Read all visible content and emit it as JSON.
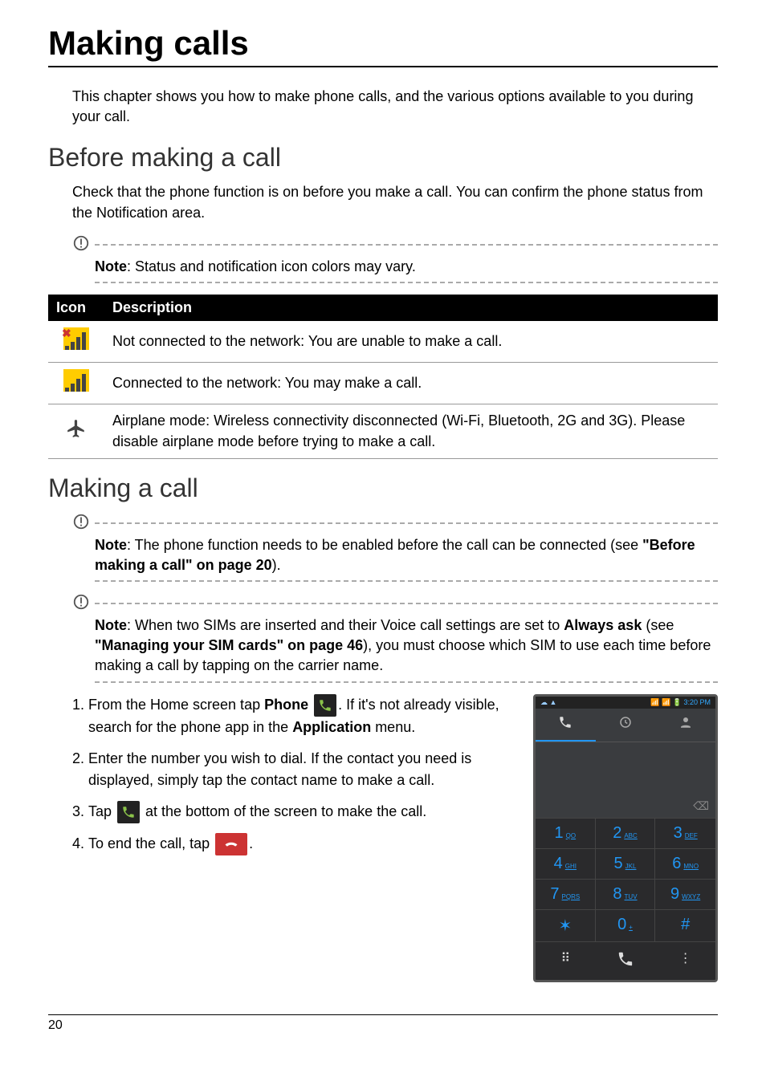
{
  "page_title": "Making calls",
  "intro": "This chapter shows you how to make phone calls, and the various options available to you during your call.",
  "section1": {
    "heading": "Before making a call",
    "text": "Check that the phone function is on before you make a call. You can confirm the phone status from the Notification area."
  },
  "note1": {
    "label": "Note",
    "text": ": Status and notification icon colors may vary."
  },
  "table": {
    "col_icon": "Icon",
    "col_desc": "Description",
    "rows": [
      {
        "desc": "Not connected to the network: You are unable to make a call."
      },
      {
        "desc": "Connected to the network: You may make a call."
      },
      {
        "desc": "Airplane mode: Wireless connectivity disconnected (Wi-Fi, Bluetooth, 2G and 3G). Please disable airplane mode before trying to make a call."
      }
    ]
  },
  "section2": {
    "heading": "Making a call"
  },
  "note2": {
    "label": "Note",
    "text1": ": The phone function needs to be enabled before the call can be connected (see ",
    "bold": "\"Before making a call\" on page 20",
    "text2": ")."
  },
  "note3": {
    "label": "Note",
    "t1": ": When two SIMs are inserted and their Voice call settings are set to ",
    "b1": "Always ask",
    "t2": " (see ",
    "b2": "\"Managing your SIM cards\" on page 46",
    "t3": "), you must choose which SIM to use each time before making a call by tapping on the carrier name."
  },
  "steps": {
    "s1a": "From the Home screen tap ",
    "s1b": "Phone",
    "s1c": ". If it's not already visible, search for the phone app in the ",
    "s1d": "Application",
    "s1e": " menu.",
    "s2": "Enter the number you wish to dial. If the contact you need is displayed, simply tap the contact name to make a call.",
    "s3a": "Tap ",
    "s3b": " at the bottom of the screen to make the call.",
    "s4a": "To end the call, tap ",
    "s4b": "."
  },
  "phone": {
    "status_left": "☁ ▲",
    "status_right": "📶 📶 🔋 3:20 PM",
    "backspace": "⌫",
    "keys": [
      {
        "n": "1",
        "l": "QO"
      },
      {
        "n": "2",
        "l": "ABC"
      },
      {
        "n": "3",
        "l": "DEF"
      },
      {
        "n": "4",
        "l": "GHI"
      },
      {
        "n": "5",
        "l": "JKL"
      },
      {
        "n": "6",
        "l": "MNO"
      },
      {
        "n": "7",
        "l": "PQRS"
      },
      {
        "n": "8",
        "l": "TUV"
      },
      {
        "n": "9",
        "l": "WXYZ"
      },
      {
        "n": "✶",
        "l": ""
      },
      {
        "n": "0",
        "l": "+"
      },
      {
        "n": "#",
        "l": ""
      }
    ],
    "footer": {
      "left": "⠿",
      "right": "⋮"
    }
  },
  "chart_data": {
    "type": "table",
    "title": "Phone status icons",
    "columns": [
      "Icon",
      "Description"
    ],
    "rows": [
      [
        "no-signal",
        "Not connected to the network: You are unable to make a call."
      ],
      [
        "signal",
        "Connected to the network: You may make a call."
      ],
      [
        "airplane-mode",
        "Airplane mode: Wireless connectivity disconnected (Wi-Fi, Bluetooth, 2G and 3G). Please disable airplane mode before trying to make a call."
      ]
    ]
  },
  "page_number": "20"
}
